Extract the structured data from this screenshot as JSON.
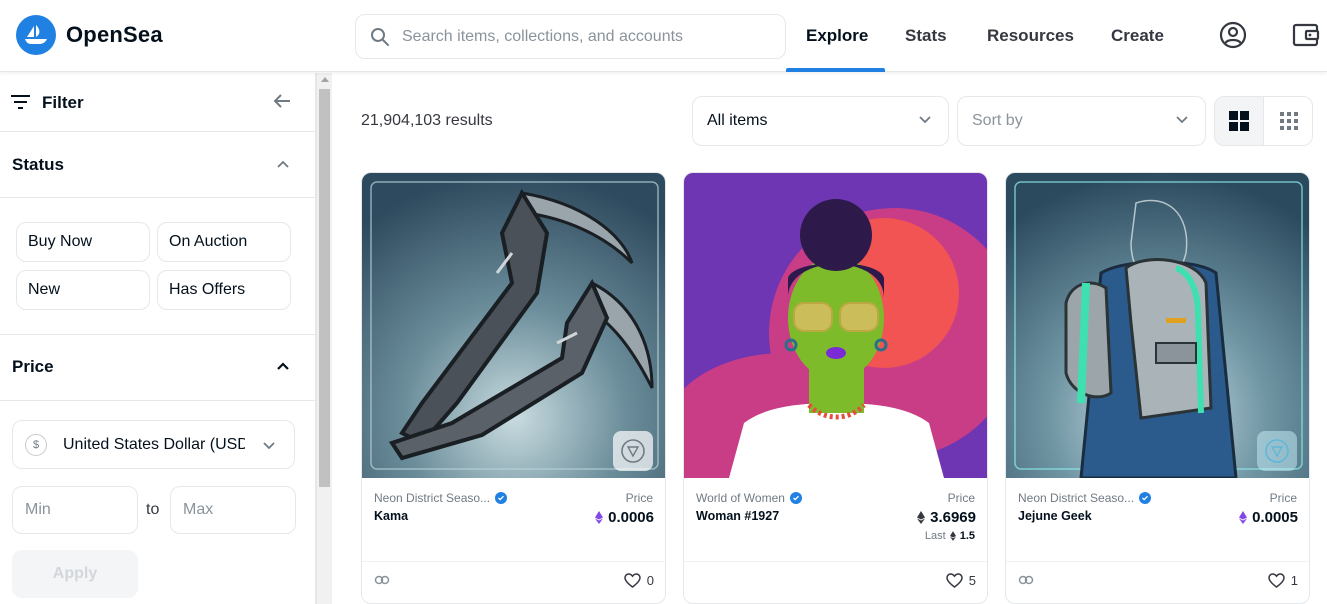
{
  "brand": {
    "name": "OpenSea",
    "logo_icon": "sailboat-icon",
    "accent": "#2081e2"
  },
  "search": {
    "placeholder": "Search items, collections, and accounts",
    "value": ""
  },
  "nav": {
    "explore": "Explore",
    "stats": "Stats",
    "resources": "Resources",
    "create": "Create",
    "active": "Explore"
  },
  "header_icons": [
    "account-circle-icon",
    "wallet-icon"
  ],
  "sidebar": {
    "filter_title": "Filter",
    "status": {
      "title": "Status",
      "options": [
        "Buy Now",
        "On Auction",
        "New",
        "Has Offers"
      ]
    },
    "price": {
      "title": "Price",
      "currency_symbol": "$",
      "currency_label": "United States Dollar (USD)",
      "min_placeholder": "Min",
      "max_placeholder": "Max",
      "to_label": "to",
      "apply_label": "Apply"
    }
  },
  "main": {
    "results_text": "21,904,103 results",
    "items_filter": "All items",
    "sort_placeholder": "Sort by",
    "view_modes": [
      "large-grid",
      "small-grid"
    ],
    "active_view": "large-grid"
  },
  "cards": [
    {
      "collection": "Neon District Seaso...",
      "verified": true,
      "name": "Kama",
      "price_label": "Price",
      "price": "0.0006",
      "currency_color": "#8247e5",
      "last_label": "",
      "last_value": "",
      "favorites": "0"
    },
    {
      "collection": "World of Women",
      "verified": true,
      "name": "Woman #1927",
      "price_label": "Price",
      "price": "3.6969",
      "currency_color": "#353840",
      "last_label": "Last",
      "last_value": "1.5",
      "favorites": "5"
    },
    {
      "collection": "Neon District Seaso...",
      "verified": true,
      "name": "Jejune Geek",
      "price_label": "Price",
      "price": "0.0005",
      "currency_color": "#8247e5",
      "last_label": "",
      "last_value": "",
      "favorites": "1"
    }
  ]
}
